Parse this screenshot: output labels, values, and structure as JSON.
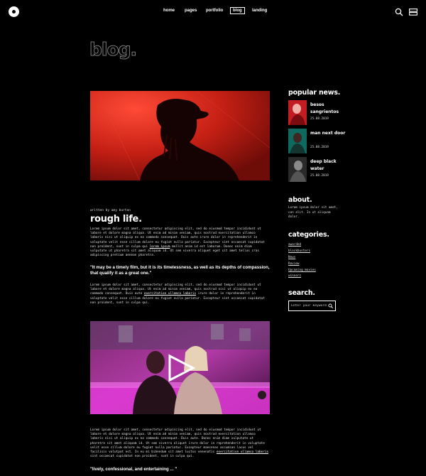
{
  "nav": {
    "items": [
      {
        "label": "home"
      },
      {
        "label": "pages"
      },
      {
        "label": "portfolio"
      },
      {
        "label": "blog"
      },
      {
        "label": "landing"
      }
    ],
    "active": "blog"
  },
  "page_title": "blog.",
  "post1": {
    "byline": "written by amy burton",
    "title": "rough life.",
    "para1_before_link": "Lorem ipsum dolor sit amet, consectetur adipiscing elit, sed do eiusmod tempor incididunt ut labore et dolore magna aliqua. Ut enim ad minim veniam, quis nostrud exercitation ullamco laboris nisi ut aliquip ex ea commodo consequat. Duis aute irure dolor in reprehenderit in voluptate velit esse cillum dolore eu fugiat nulla pariatur. Excepteur sint occaecat cupidatat non proident, sunt in culpa qui ",
    "para1_link": "lorem ipsum",
    "para1_after_link": " mollit anim id est laborum. Donec enim diam vulputate ut pharetra sit amet aliquam id. Ut sem viverra aliquet eget sit amet tellus cras adipiscing pretium aenean pharetra.",
    "quote": "\"It may be a timely film, but it is its timelessness, as well as its depths of compassion, that qualify it as a great one.\"",
    "para2_before_link": "Lorem ipsum dolor sit amet, consectetur adipiscing elit, sed do eiusmod tempor incididunt ut labore et dolore magna aliqua. Ut enim ad minim veniam, quis nostrud nisi ut aliquip ex ea commodo consequat. Duis aute ",
    "para2_link": "exercitation ullamco laboris",
    "para2_after_link": " irure dolor in reprehenderit in voluptate velit esse cillum dolore eu fugiat nulla pariatur. Excepteur sint occaecat cupidatat non proident, sunt in culpa qui."
  },
  "post2": {
    "para1_before_link": "Lorem ipsum dolor sit amet, consectetur adipiscing elit, sed do eiusmod tempor incididunt ut labore et dolore magna aliqua. Ut enim ad minim veniam, quis nostrud exercitation ullamco laboris nisi ut aliquip ex ea commodo consequat. Duis aute. Donec enim diam vulputate ut pharetra sit amet aliquam id. Ut sem viverra aliquet irure dolor in reprehenderit in voluptate velit esse cillum dolore eu fugiat nulla pariatur. Excepteur maecenas accumsan lacus vel facilisis volutpat est. In eu mi bibendum sit amet luctus venenatis ",
    "para1_link": "exercitation ullamco laboris",
    "para1_after_link": " sint occaecat cupidatat non proident, sunt in culpa qui.",
    "quote": "\"lively, confessional, and entertaining ... \""
  },
  "sidebar": {
    "popular_heading": "popular news.",
    "news": [
      {
        "title": "besos sangrientos",
        "date": "25.08.2019"
      },
      {
        "title": "man next door",
        "date": "25.08.2019"
      },
      {
        "title": "deep black water",
        "date": "25.08.2019"
      }
    ],
    "about_heading": "about.",
    "about_text": "Lorem ipsum dolor sit amet, con elit. In ut aliquam dolor.",
    "categories_heading": "categories.",
    "categories": [
      "awarded",
      "blockbusters",
      "News",
      "Review",
      "Upcoming movies",
      "winners"
    ],
    "search_heading": "search.",
    "search_placeholder": "Enter your keyword"
  },
  "colors": {
    "background": "#000000",
    "text": "#ffffff",
    "accent_red": "#c8231a",
    "accent_magenta": "#d23bc8"
  },
  "icons": [
    "logo-icon",
    "search-icon",
    "menu-icon",
    "play-icon"
  ]
}
